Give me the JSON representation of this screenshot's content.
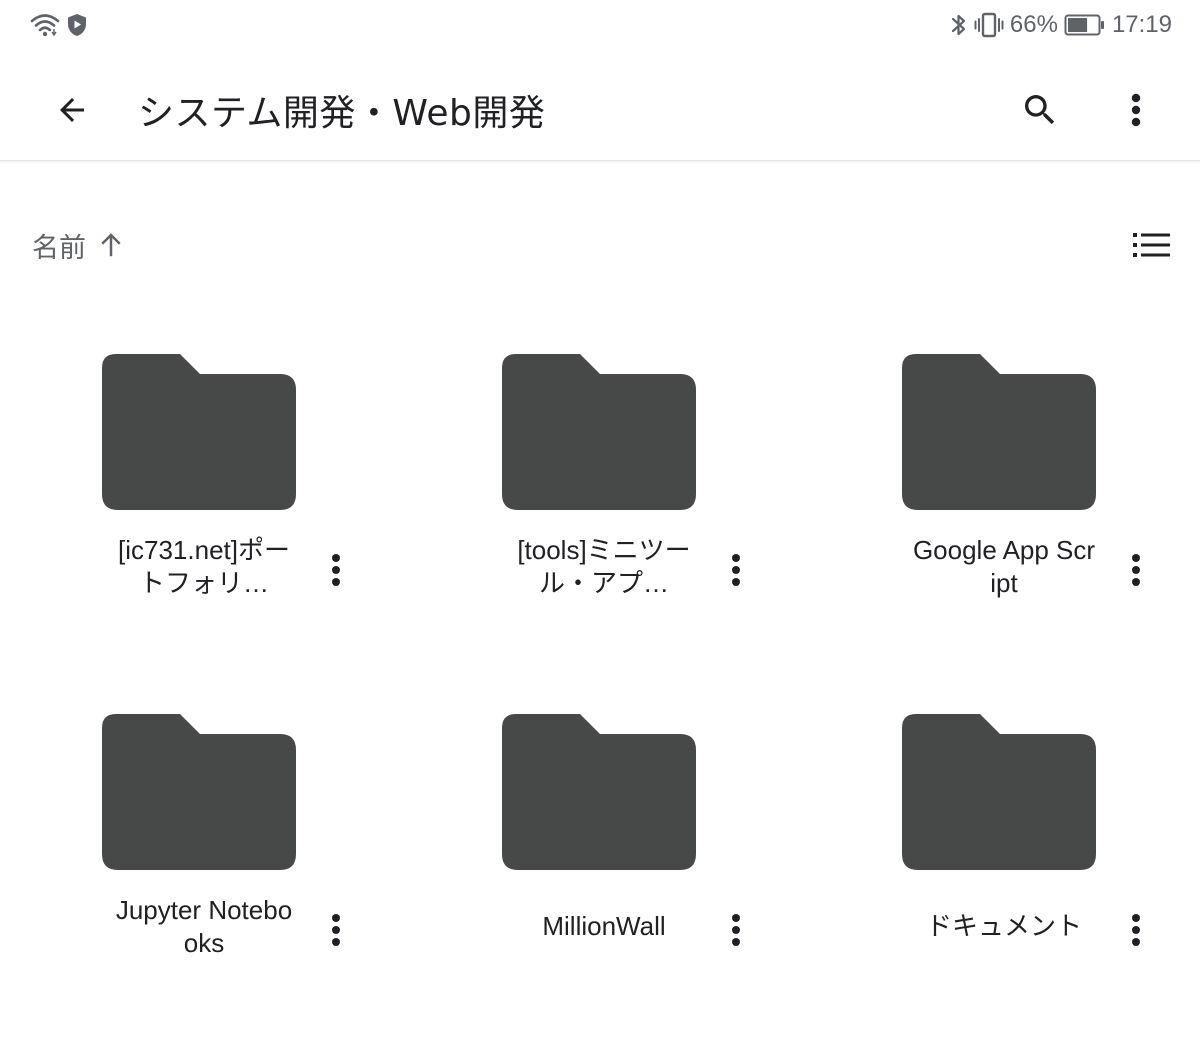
{
  "status_bar": {
    "battery_percent": "66%",
    "battery_level": 0.66,
    "time": "17:19",
    "icons_left": [
      "wifi-icon",
      "vpn-shield-icon"
    ],
    "icons_right": [
      "bluetooth-icon",
      "vibrate-icon",
      "battery-icon"
    ]
  },
  "app_bar": {
    "title": "システム開発・Web開発",
    "back_icon": "arrow-back-icon",
    "search_icon": "search-icon",
    "menu_icon": "more-vert-icon"
  },
  "sort": {
    "label": "名前",
    "direction_icon": "arrow-up-icon"
  },
  "view_toggle_icon": "list-view-icon",
  "folders": [
    {
      "name": "[ic731.net]ポートフォリ…"
    },
    {
      "name": "[tools]ミニツール・アプ…"
    },
    {
      "name": "Google App Script"
    },
    {
      "name": "Jupyter Notebooks"
    },
    {
      "name": "MillionWall"
    },
    {
      "name": "ドキュメント"
    }
  ],
  "colors": {
    "folder": "#474848",
    "icon": "#202124",
    "secondary_text": "#5f6368",
    "divider": "#e3e3e3"
  }
}
